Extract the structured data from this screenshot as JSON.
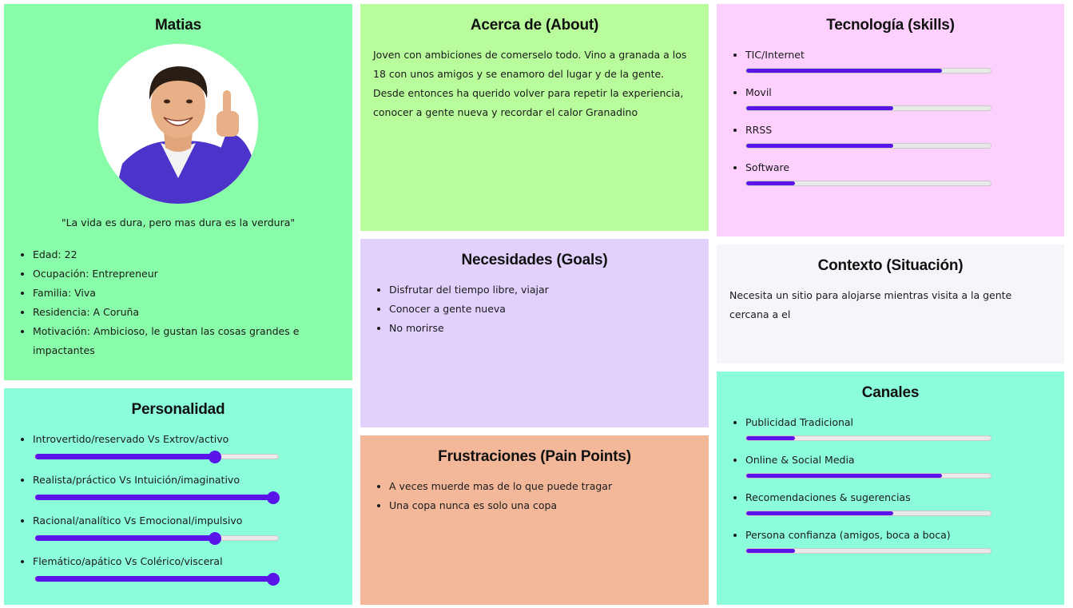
{
  "colors": {
    "profile_bg": "#88fca8",
    "about_bg": "#b8fc9b",
    "tech_bg": "#fdd0fd",
    "personality_bg": "#8cfddb",
    "goals_bg": "#e1d1fc",
    "context_bg": "#f4f6f9",
    "pain_bg": "#f3b89a",
    "channels_bg": "#8cfddb",
    "accent": "#5a13e8"
  },
  "profile": {
    "name": "Matias",
    "avatar_icon": "avatar-photo",
    "quote": "\"La vida es dura, pero mas dura es la verdura\"",
    "details": [
      "Edad: 22",
      "Ocupación: Entrepreneur",
      "Familia: Viva",
      "Residencia: A Coruña",
      "Motivación: Ambicioso, le gustan las cosas grandes e impactantes"
    ]
  },
  "personality": {
    "title": "Personalidad",
    "traits": [
      {
        "label": "Introvertido/reservado Vs Extrov/activo",
        "value": 0.74
      },
      {
        "label": "Realista/práctico Vs Intuición/imaginativo",
        "value": 0.98
      },
      {
        "label": "Racional/analítico Vs Emocional/impulsivo",
        "value": 0.74
      },
      {
        "label": "Flemático/apático Vs Colérico/visceral",
        "value": 0.98
      }
    ]
  },
  "about": {
    "title": "Acerca de (About)",
    "text": "Joven con ambiciones de comerselo todo. Vino a granada a los 18 con unos amigos y se enamoro del lugar y de la gente. Desde entonces ha querido volver para repetir la experiencia, conocer a gente nueva y recordar el calor Granadino"
  },
  "goals": {
    "title": "Necesidades (Goals)",
    "items": [
      "Disfrutar del tiempo libre, viajar",
      "Conocer a gente nueva",
      "No morirse"
    ]
  },
  "pain_points": {
    "title": "Frustraciones (Pain Points)",
    "items": [
      "A veces muerde mas de lo que puede tragar",
      "Una copa nunca es solo una copa"
    ]
  },
  "tech": {
    "title": "Tecnología (skills)",
    "skills": [
      {
        "label": "TIC/Internet",
        "value": 0.8
      },
      {
        "label": "Movil",
        "value": 0.6
      },
      {
        "label": "RRSS",
        "value": 0.6
      },
      {
        "label": "Software",
        "value": 0.2
      }
    ]
  },
  "context": {
    "title": "Contexto (Situación)",
    "text": "Necesita un sitio para alojarse mientras visita a la gente cercana a el"
  },
  "channels": {
    "title": "Canales",
    "items": [
      {
        "label": "Publicidad Tradicional",
        "value": 0.2
      },
      {
        "label": "Online & Social Media",
        "value": 0.8
      },
      {
        "label": "Recomendaciones & sugerencias",
        "value": 0.6
      },
      {
        "label": "Persona confianza (amigos, boca a boca)",
        "value": 0.2
      }
    ]
  }
}
